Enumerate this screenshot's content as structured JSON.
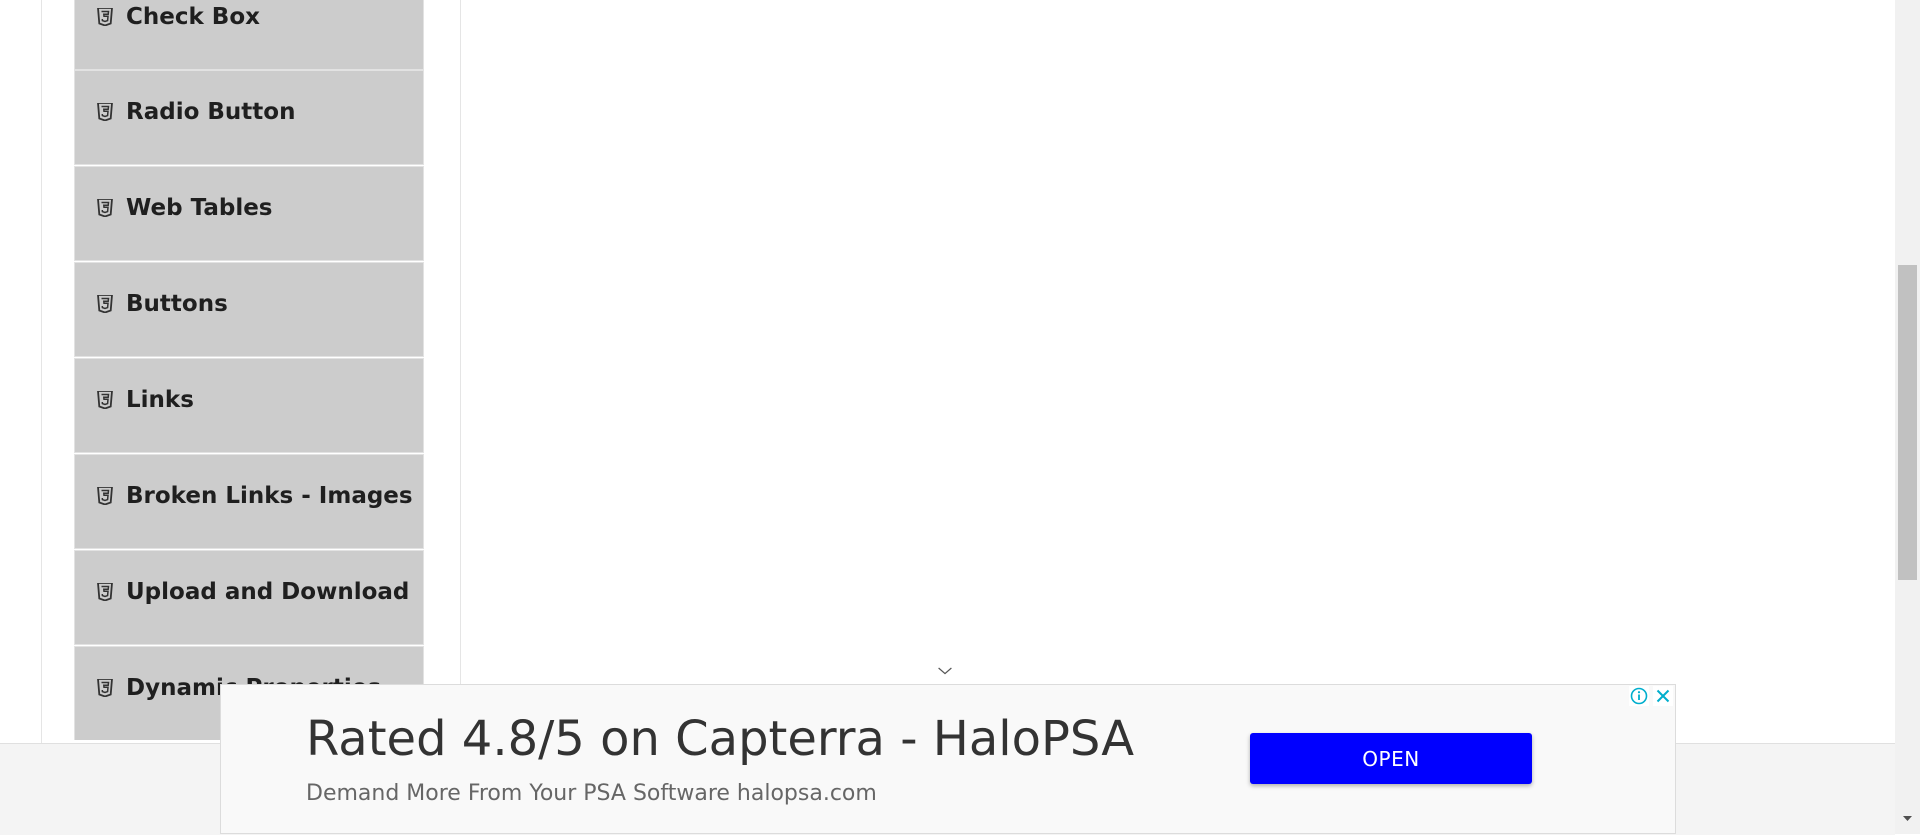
{
  "sidebar": {
    "items": [
      {
        "label": "Check Box",
        "icon": "html5-icon"
      },
      {
        "label": "Radio Button",
        "icon": "html5-icon"
      },
      {
        "label": "Web Tables",
        "icon": "html5-icon"
      },
      {
        "label": "Buttons",
        "icon": "html5-icon"
      },
      {
        "label": "Links",
        "icon": "html5-icon"
      },
      {
        "label": "Broken Links - Images",
        "icon": "html5-icon"
      },
      {
        "label": "Upload and Download",
        "icon": "html5-icon"
      },
      {
        "label": "Dynamic Properties",
        "icon": "html5-icon"
      }
    ]
  },
  "ad": {
    "headline": "Rated 4.8/5 on Capterra - HaloPSA",
    "subtext": "Demand More From Your PSA Software halopsa.com",
    "button_label": "OPEN",
    "button_color": "#0000ff"
  }
}
